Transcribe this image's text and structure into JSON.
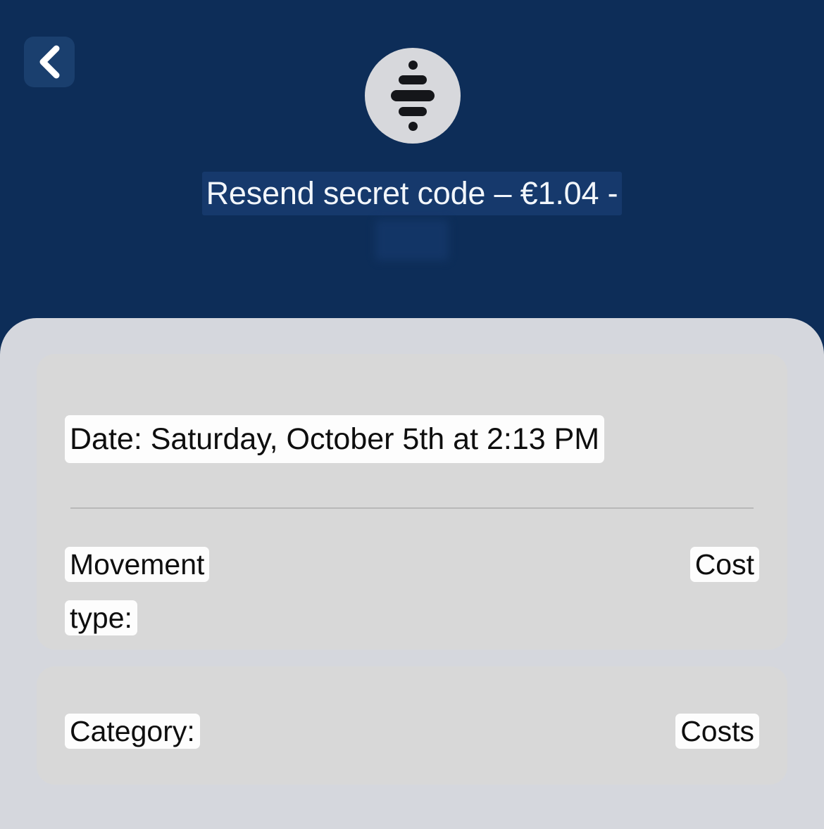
{
  "header": {
    "back_icon": "chevron-left-icon",
    "avatar_icon": "diamond-bars-icon",
    "title": "Resend secret code – €1.04 -",
    "subtitle": "-- ----"
  },
  "sheet": {
    "detail_card": {
      "date_label": "Date: Saturday, October 5th at 2:13 PM",
      "movement_type_label_line1": "Movement",
      "movement_type_label_line2": "type:",
      "movement_type_value": "Cost"
    },
    "category_card": {
      "category_label": "Category:",
      "category_value": "Costs"
    }
  },
  "colors": {
    "header_background": "#0d2d58",
    "selection_highlight": "#16396c",
    "sheet_background": "#d5d7dd",
    "card_background": "#d8d8d8",
    "text_highlight": "#fdfdfd",
    "text_primary": "#0e0e0e",
    "avatar_background": "#d7d8dc",
    "back_button_background": "#1a3f6e"
  }
}
